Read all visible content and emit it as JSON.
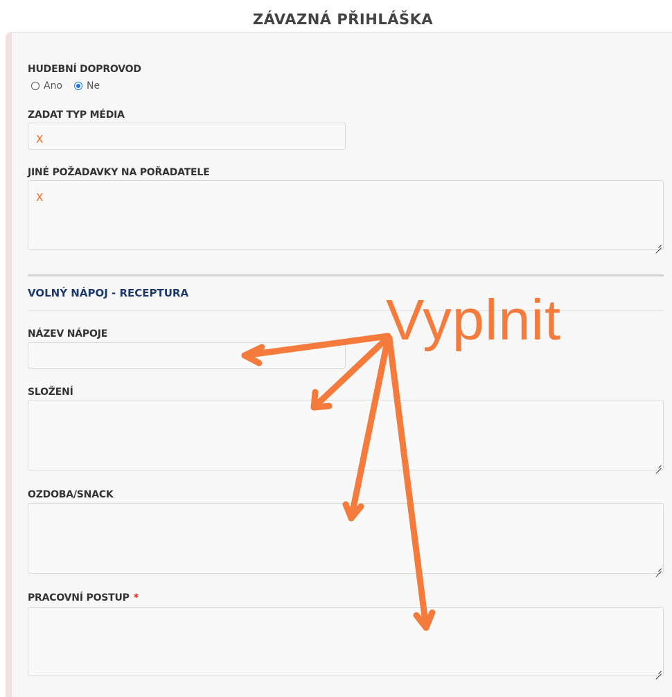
{
  "page": {
    "title": "ZÁVAZNÁ PŘIHLÁŠKA"
  },
  "form": {
    "music": {
      "label": "HUDEBNÍ DOPROVOD",
      "options": [
        {
          "label": "Ano",
          "checked": false
        },
        {
          "label": "Ne",
          "checked": true
        }
      ]
    },
    "media_type": {
      "label": "ZADAT TYP MÉDIA",
      "value": "X"
    },
    "other_requests": {
      "label": "JINÉ POŽADAVKY NA POŘADATELE",
      "value": "X"
    },
    "section": {
      "title": "VOLNÝ NÁPOJ - RECEPTURA"
    },
    "drink_name": {
      "label": "NÁZEV NÁPOJE",
      "value": ""
    },
    "composition": {
      "label": "SLOŽENÍ",
      "value": ""
    },
    "garnish": {
      "label": "OZDOBA/SNACK",
      "value": ""
    },
    "procedure": {
      "label": "PRACOVNÍ POSTUP",
      "required_mark": "*",
      "value": ""
    }
  },
  "annotation": {
    "text": "Vyplnit",
    "color": "#f47b3b"
  },
  "colors": {
    "accent_orange": "#f26b21",
    "section_blue": "#1d3a6b",
    "required_red": "#e0241b",
    "radio_blue": "#1a73e8"
  }
}
